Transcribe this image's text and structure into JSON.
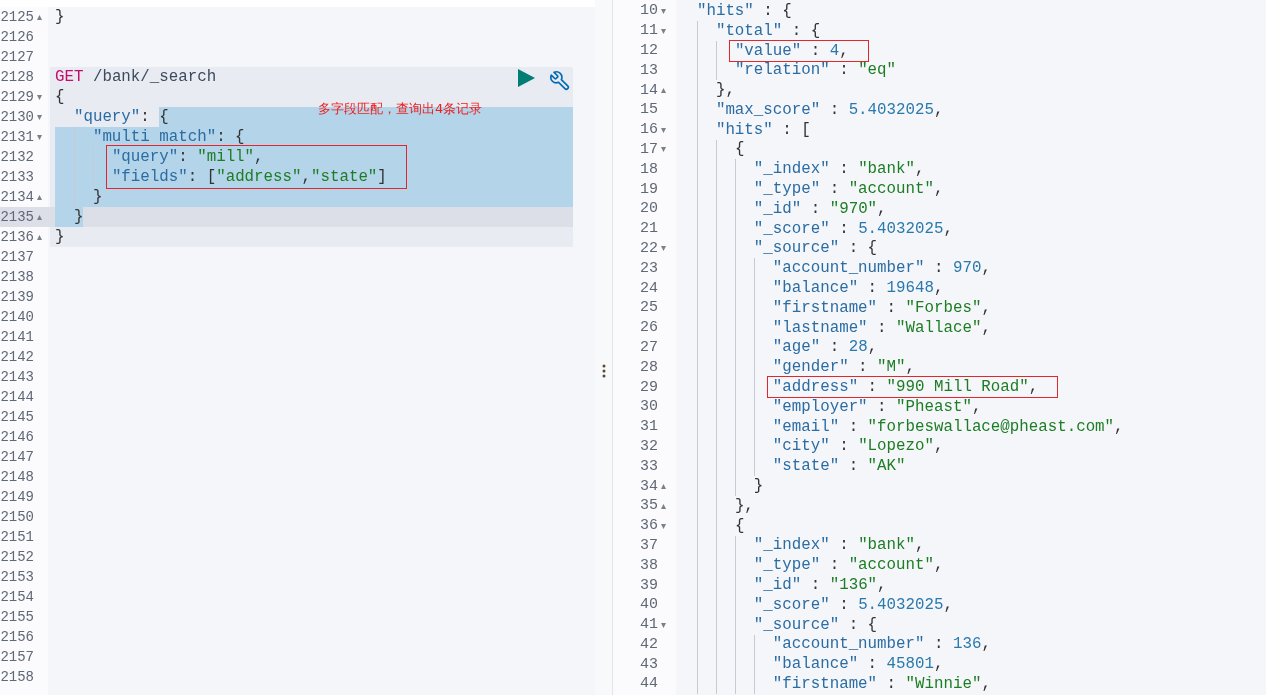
{
  "request_editor": {
    "lines": [
      {
        "kind": "line",
        "number": "2125",
        "text": "}",
        "fold": "▴",
        "selected": false,
        "active": false
      },
      {
        "kind": "line",
        "number": "2126",
        "selected": false,
        "active": false
      },
      {
        "kind": "line",
        "number": "2127",
        "selected": false,
        "active": false
      },
      {
        "kind": "request",
        "lines": [
          {
            "kind": "line",
            "number": "2128",
            "text": "GET /bank/_search",
            "selected": false,
            "active": false
          },
          {
            "kind": "line",
            "number": "2129",
            "text": "{",
            "fold": "▾",
            "selected": false,
            "active": false
          },
          {
            "kind": "line",
            "number": "2130",
            "text": "  \"query\": {",
            "fold": "▾",
            "selected": true,
            "active": false,
            "note": "多字段匹配，查询出4条记录"
          },
          {
            "kind": "line",
            "number": "2131",
            "text": "    \"multi match\": {",
            "fold": "▾",
            "selected": true,
            "active": false
          },
          {
            "kind": "box",
            "lines": [
              {
                "kind": "line",
                "number": "2132",
                "text": "      \"query\": \"mill\",",
                "selected": true,
                "active": false
              },
              {
                "kind": "line",
                "number": "2133",
                "text": "      \"fields\": [\"address\",\"state\"]",
                "selected": true,
                "active": false
              }
            ]
          },
          {
            "kind": "line",
            "number": "2134",
            "text": "    }",
            "fold": "▴",
            "selected": true,
            "active": false
          },
          {
            "kind": "line",
            "number": "2135",
            "text": "  }",
            "fold": "▴",
            "selected": true,
            "active": true
          },
          {
            "kind": "line",
            "number": "2136",
            "text": "}",
            "fold": "▴",
            "selected": false,
            "active": false
          }
        ]
      },
      {
        "kind": "line",
        "number": "2137",
        "selected": false,
        "active": false
      },
      {
        "kind": "line",
        "number": "2138",
        "selected": false,
        "active": false
      },
      {
        "kind": "line",
        "number": "2139",
        "selected": false,
        "active": false
      },
      {
        "kind": "line",
        "number": "2140",
        "selected": false,
        "active": false
      },
      {
        "kind": "line",
        "number": "2141",
        "selected": false,
        "active": false
      },
      {
        "kind": "line",
        "number": "2142",
        "selected": false,
        "active": false
      },
      {
        "kind": "line",
        "number": "2143",
        "selected": false,
        "active": false
      },
      {
        "kind": "line",
        "number": "2144",
        "selected": false,
        "active": false
      },
      {
        "kind": "line",
        "number": "2145",
        "selected": false,
        "active": false
      },
      {
        "kind": "line",
        "number": "2146",
        "selected": false,
        "active": false
      },
      {
        "kind": "line",
        "number": "2147",
        "selected": false,
        "active": false
      },
      {
        "kind": "line",
        "number": "2148",
        "selected": false,
        "active": false
      },
      {
        "kind": "line",
        "number": "2149",
        "selected": false,
        "active": false
      },
      {
        "kind": "line",
        "number": "2150",
        "selected": false,
        "active": false
      },
      {
        "kind": "line",
        "number": "2151",
        "selected": false,
        "active": false
      },
      {
        "kind": "line",
        "number": "2152",
        "selected": false,
        "active": false
      },
      {
        "kind": "line",
        "number": "2153",
        "selected": false,
        "active": false
      },
      {
        "kind": "line",
        "number": "2154",
        "selected": false,
        "active": false
      },
      {
        "kind": "line",
        "number": "2155",
        "selected": false,
        "active": false
      },
      {
        "kind": "line",
        "number": "2156",
        "selected": false,
        "active": false
      },
      {
        "kind": "line",
        "number": "2157",
        "selected": false,
        "active": false
      },
      {
        "kind": "line",
        "number": "2158",
        "selected": false,
        "active": false
      }
    ]
  },
  "response_editor": {
    "lines": [
      {
        "kind": "line",
        "number": "10",
        "text": "  \"hits\" : {",
        "fold": "▾"
      },
      {
        "kind": "line",
        "number": "11",
        "text": "    \"total\" : {",
        "fold": "▾"
      },
      {
        "kind": "box",
        "lines": [
          {
            "kind": "line",
            "number": "12",
            "text": "      \"value\" : 4,"
          }
        ]
      },
      {
        "kind": "line",
        "number": "13",
        "text": "      \"relation\" : \"eq\""
      },
      {
        "kind": "line",
        "number": "14",
        "text": "    },",
        "fold": "▴"
      },
      {
        "kind": "line",
        "number": "15",
        "text": "    \"max_score\" : 5.4032025,"
      },
      {
        "kind": "line",
        "number": "16",
        "text": "    \"hits\" : [",
        "fold": "▾"
      },
      {
        "kind": "line",
        "number": "17",
        "text": "      {",
        "fold": "▾"
      },
      {
        "kind": "line",
        "number": "18",
        "text": "        \"_index\" : \"bank\","
      },
      {
        "kind": "line",
        "number": "19",
        "text": "        \"_type\" : \"account\","
      },
      {
        "kind": "line",
        "number": "20",
        "text": "        \"_id\" : \"970\","
      },
      {
        "kind": "line",
        "number": "21",
        "text": "        \"_score\" : 5.4032025,"
      },
      {
        "kind": "line",
        "number": "22",
        "text": "        \"_source\" : {",
        "fold": "▾"
      },
      {
        "kind": "line",
        "number": "23",
        "text": "          \"account_number\" : 970,"
      },
      {
        "kind": "line",
        "number": "24",
        "text": "          \"balance\" : 19648,"
      },
      {
        "kind": "line",
        "number": "25",
        "text": "          \"firstname\" : \"Forbes\","
      },
      {
        "kind": "line",
        "number": "26",
        "text": "          \"lastname\" : \"Wallace\","
      },
      {
        "kind": "line",
        "number": "27",
        "text": "          \"age\" : 28,"
      },
      {
        "kind": "line",
        "number": "28",
        "text": "          \"gender\" : \"M\","
      },
      {
        "kind": "box",
        "lines": [
          {
            "kind": "line",
            "number": "29",
            "text": "          \"address\" : \"990 Mill Road\","
          }
        ]
      },
      {
        "kind": "line",
        "number": "30",
        "text": "          \"employer\" : \"Pheast\","
      },
      {
        "kind": "line",
        "number": "31",
        "text": "          \"email\" : \"forbeswallace@pheast.com\","
      },
      {
        "kind": "line",
        "number": "32",
        "text": "          \"city\" : \"Lopezo\","
      },
      {
        "kind": "line",
        "number": "33",
        "text": "          \"state\" : \"AK\""
      },
      {
        "kind": "line",
        "number": "34",
        "text": "        }",
        "fold": "▴"
      },
      {
        "kind": "line",
        "number": "35",
        "text": "      },",
        "fold": "▴"
      },
      {
        "kind": "line",
        "number": "36",
        "text": "      {",
        "fold": "▾"
      },
      {
        "kind": "line",
        "number": "37",
        "text": "        \"_index\" : \"bank\","
      },
      {
        "kind": "line",
        "number": "38",
        "text": "        \"_type\" : \"account\","
      },
      {
        "kind": "line",
        "number": "39",
        "text": "        \"_id\" : \"136\","
      },
      {
        "kind": "line",
        "number": "40",
        "text": "        \"_score\" : 5.4032025,"
      },
      {
        "kind": "line",
        "number": "41",
        "text": "        \"_source\" : {",
        "fold": "▾"
      },
      {
        "kind": "line",
        "number": "42",
        "text": "          \"account_number\" : 136,"
      },
      {
        "kind": "line",
        "number": "43",
        "text": "          \"balance\" : 45801,"
      },
      {
        "kind": "line",
        "number": "44",
        "text": "          \"firstname\" : \"Winnie\","
      }
    ]
  }
}
